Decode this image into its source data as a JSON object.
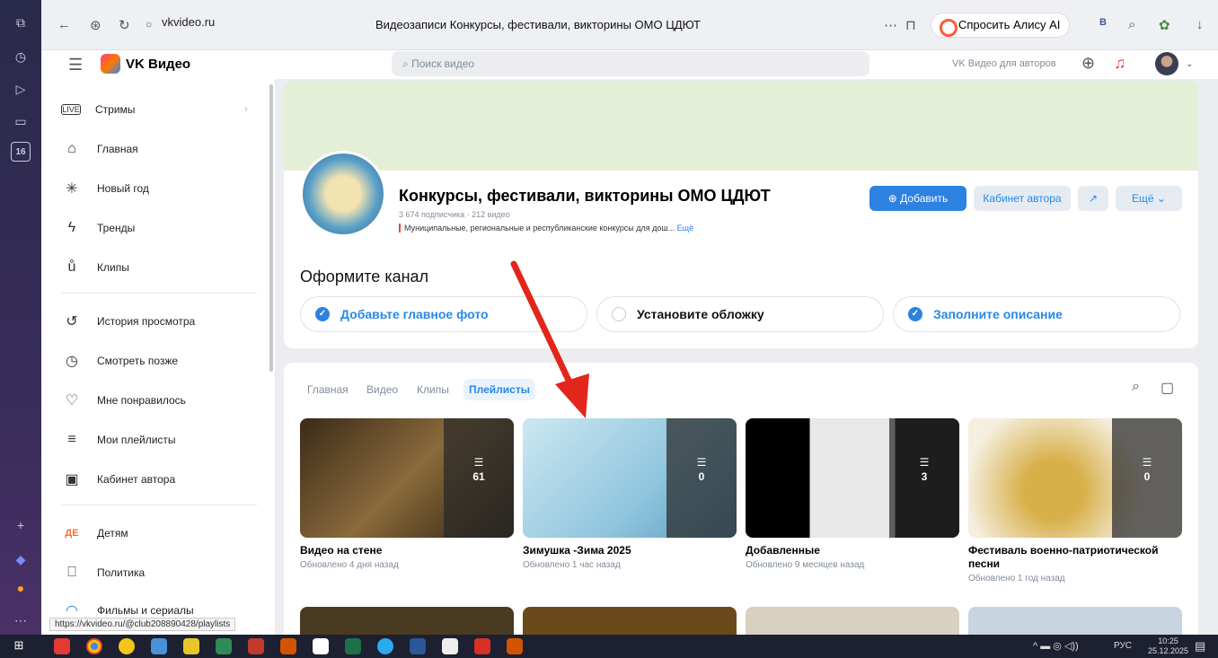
{
  "browser": {
    "url": "vkvideo.ru",
    "page_title": "Видеозаписи Конкурсы, фестивали, викторины ОМО ЦДЮТ",
    "alisa_button": "Спросить Алису AI",
    "status_url": "https://vkvideo.ru/@club208890428/playlists"
  },
  "header": {
    "app_name": "VK Видео",
    "search_placeholder": "Поиск видео",
    "for_authors": "VK Видео для авторов"
  },
  "sidebar": {
    "items": [
      {
        "label": "Стримы",
        "icon": "live-icon"
      },
      {
        "label": "Главная",
        "icon": "home-icon"
      },
      {
        "label": "Новый год",
        "icon": "snowflake-icon"
      },
      {
        "label": "Тренды",
        "icon": "trends-icon"
      },
      {
        "label": "Клипы",
        "icon": "clips-icon"
      },
      {
        "label": "История просмотра",
        "icon": "history-icon"
      },
      {
        "label": "Смотреть позже",
        "icon": "clock-icon"
      },
      {
        "label": "Мне понравилось",
        "icon": "heart-icon"
      },
      {
        "label": "Мои плейлисты",
        "icon": "playlist-icon"
      },
      {
        "label": "Кабинет автора",
        "icon": "author-cabinet-icon"
      },
      {
        "label": "Детям",
        "icon": "kids-icon"
      },
      {
        "label": "Политика",
        "icon": "book-icon"
      },
      {
        "label": "Фильмы и сериалы",
        "icon": "movies-icon"
      }
    ]
  },
  "channel": {
    "title": "Конкурсы, фестивали, викторины ОМО ЦДЮТ",
    "stats": "3 674 подписчика · 212 видео",
    "description": "Муниципальные, региональные и республиканские конкурсы для дош...",
    "description_more": "Ещё",
    "add_button": "Добавить",
    "cabinet_button": "Кабинет автора",
    "more_button": "Ещё"
  },
  "setup": {
    "title": "Оформите канал",
    "steps": [
      {
        "label": "Добавьте главное фото",
        "done": true
      },
      {
        "label": "Установите обложку",
        "done": false
      },
      {
        "label": "Заполните описание",
        "done": true
      }
    ]
  },
  "tabs": [
    "Главная",
    "Видео",
    "Клипы",
    "Плейлисты"
  ],
  "active_tab": "Плейлисты",
  "playlists": [
    {
      "title": "Видео на стене",
      "updated": "Обновлено 4 дня назад",
      "count": "61"
    },
    {
      "title": "Зимушка -Зима 2025",
      "updated": "Обновлено 1 час назад",
      "count": "0"
    },
    {
      "title": "Добавленные",
      "updated": "Обновлено 9 месяцев назад",
      "count": "3"
    },
    {
      "title": "Фестиваль военно-патриотической песни",
      "updated": "Обновлено 1 год назад",
      "count": "0"
    }
  ],
  "taskbar": {
    "lang": "РУС",
    "time": "10:25",
    "date": "25.12.2025"
  },
  "colors": {
    "accent": "#2d81e0",
    "arrow": "#e3261b",
    "cover": "#e4efd7"
  }
}
